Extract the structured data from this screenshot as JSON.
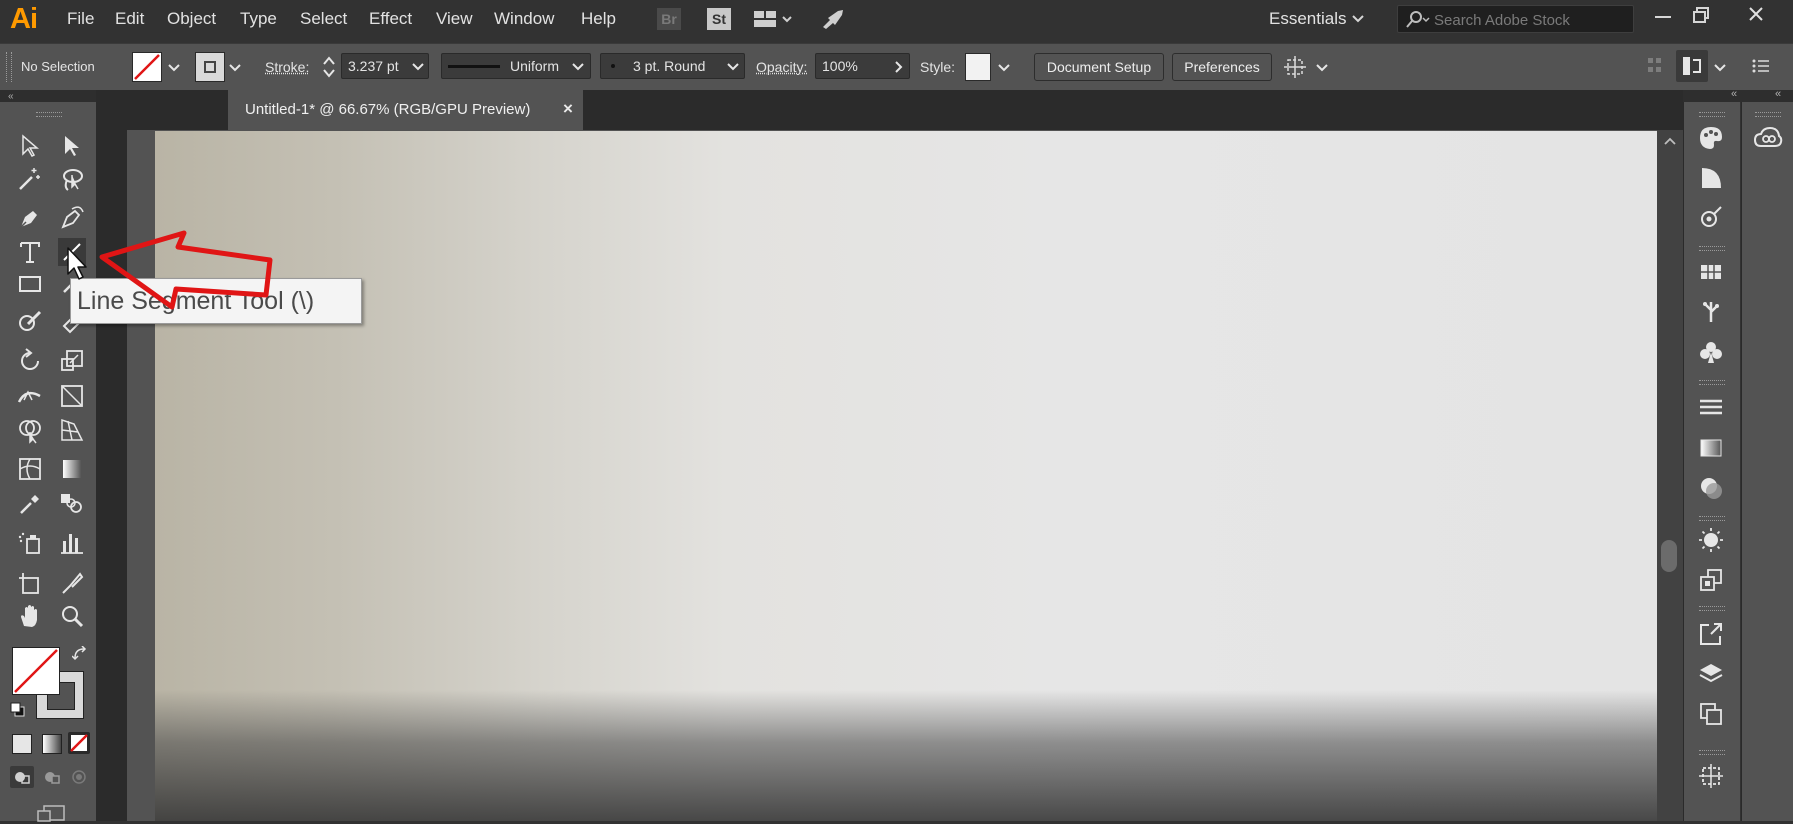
{
  "app": {
    "logo": "Ai",
    "menu": [
      "File",
      "Edit",
      "Object",
      "Type",
      "Select",
      "Effect",
      "View",
      "Window",
      "Help"
    ],
    "bridge_label": "Br",
    "stock_label": "St",
    "workspace": "Essentials",
    "search_placeholder": "Search Adobe Stock"
  },
  "control_bar": {
    "selection": "No Selection",
    "stroke_label": "Stroke:",
    "stroke_value": "3.237 pt",
    "profile": "Uniform",
    "brush": "3 pt. Round",
    "opacity_label": "Opacity:",
    "opacity_value": "100%",
    "style_label": "Style:",
    "document_setup": "Document Setup",
    "preferences": "Preferences"
  },
  "document": {
    "tab_title": "Untitled-1* @ 66.67% (RGB/GPU Preview)",
    "close_glyph": "×"
  },
  "tooltip": {
    "text": "Line Segment Tool (\\)"
  },
  "colors": {
    "accent_logo": "#ff9a00",
    "annotation_arrow": "#e01515",
    "no_fill_slash": "#e01515"
  }
}
